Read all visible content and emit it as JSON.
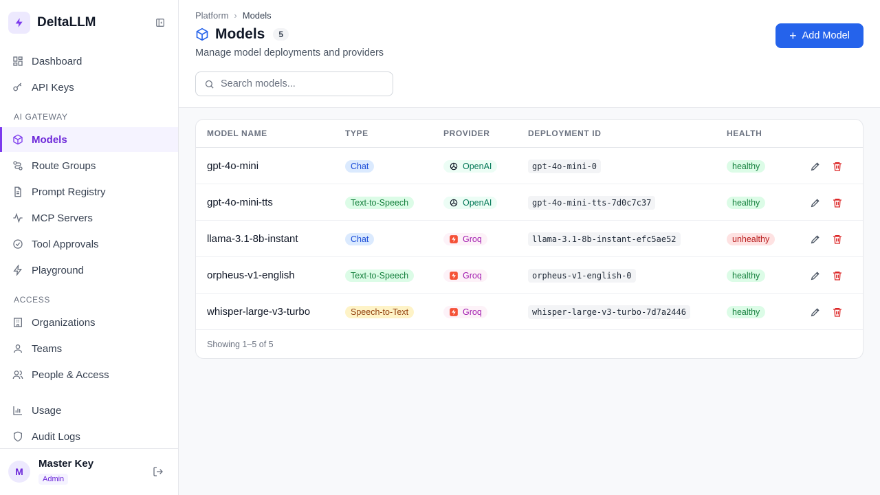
{
  "app": {
    "name": "DeltaLLM"
  },
  "sidebar": {
    "top_items": [
      {
        "label": "Dashboard",
        "icon": "dashboard-icon"
      },
      {
        "label": "API Keys",
        "icon": "key-icon"
      }
    ],
    "sections": [
      {
        "label": "AI GATEWAY",
        "items": [
          {
            "label": "Models",
            "icon": "box-icon",
            "active": true
          },
          {
            "label": "Route Groups",
            "icon": "route-icon"
          },
          {
            "label": "Prompt Registry",
            "icon": "document-icon"
          },
          {
            "label": "MCP Servers",
            "icon": "activity-icon"
          },
          {
            "label": "Tool Approvals",
            "icon": "check-circle-icon"
          },
          {
            "label": "Playground",
            "icon": "zap-icon"
          }
        ]
      },
      {
        "label": "ACCESS",
        "items": [
          {
            "label": "Organizations",
            "icon": "building-icon"
          },
          {
            "label": "Teams",
            "icon": "user-icon"
          },
          {
            "label": "People & Access",
            "icon": "users-icon"
          }
        ]
      }
    ],
    "bottom_items": [
      {
        "label": "Usage",
        "icon": "bar-chart-icon"
      },
      {
        "label": "Audit Logs",
        "icon": "shield-icon"
      }
    ],
    "user": {
      "initial": "M",
      "name": "Master Key",
      "role": "Admin"
    }
  },
  "breadcrumb": {
    "parent": "Platform",
    "current": "Models"
  },
  "page": {
    "title": "Models",
    "count": "5",
    "subtitle": "Manage model deployments and providers",
    "search_placeholder": "Search models...",
    "add_label": "Add Model"
  },
  "table": {
    "columns": [
      "MODEL NAME",
      "TYPE",
      "PROVIDER",
      "DEPLOYMENT ID",
      "HEALTH"
    ],
    "rows": [
      {
        "name": "gpt-4o-mini",
        "type": "Chat",
        "provider": "OpenAI",
        "deployment": "gpt-4o-mini-0",
        "health": "healthy"
      },
      {
        "name": "gpt-4o-mini-tts",
        "type": "Text-to-Speech",
        "provider": "OpenAI",
        "deployment": "gpt-4o-mini-tts-7d0c7c37",
        "health": "healthy"
      },
      {
        "name": "llama-3.1-8b-instant",
        "type": "Chat",
        "provider": "Groq",
        "deployment": "llama-3.1-8b-instant-efc5ae52",
        "health": "unhealthy"
      },
      {
        "name": "orpheus-v1-english",
        "type": "Text-to-Speech",
        "provider": "Groq",
        "deployment": "orpheus-v1-english-0",
        "health": "healthy"
      },
      {
        "name": "whisper-large-v3-turbo",
        "type": "Speech-to-Text",
        "provider": "Groq",
        "deployment": "whisper-large-v3-turbo-7d7a2446",
        "health": "healthy"
      }
    ],
    "footer": "Showing 1–5 of 5"
  },
  "colors": {
    "accent": "#7c3aed",
    "primary_button": "#2563eb",
    "groq": "#f55036",
    "unhealthy": "#b91c1c",
    "healthy": "#15803d"
  }
}
